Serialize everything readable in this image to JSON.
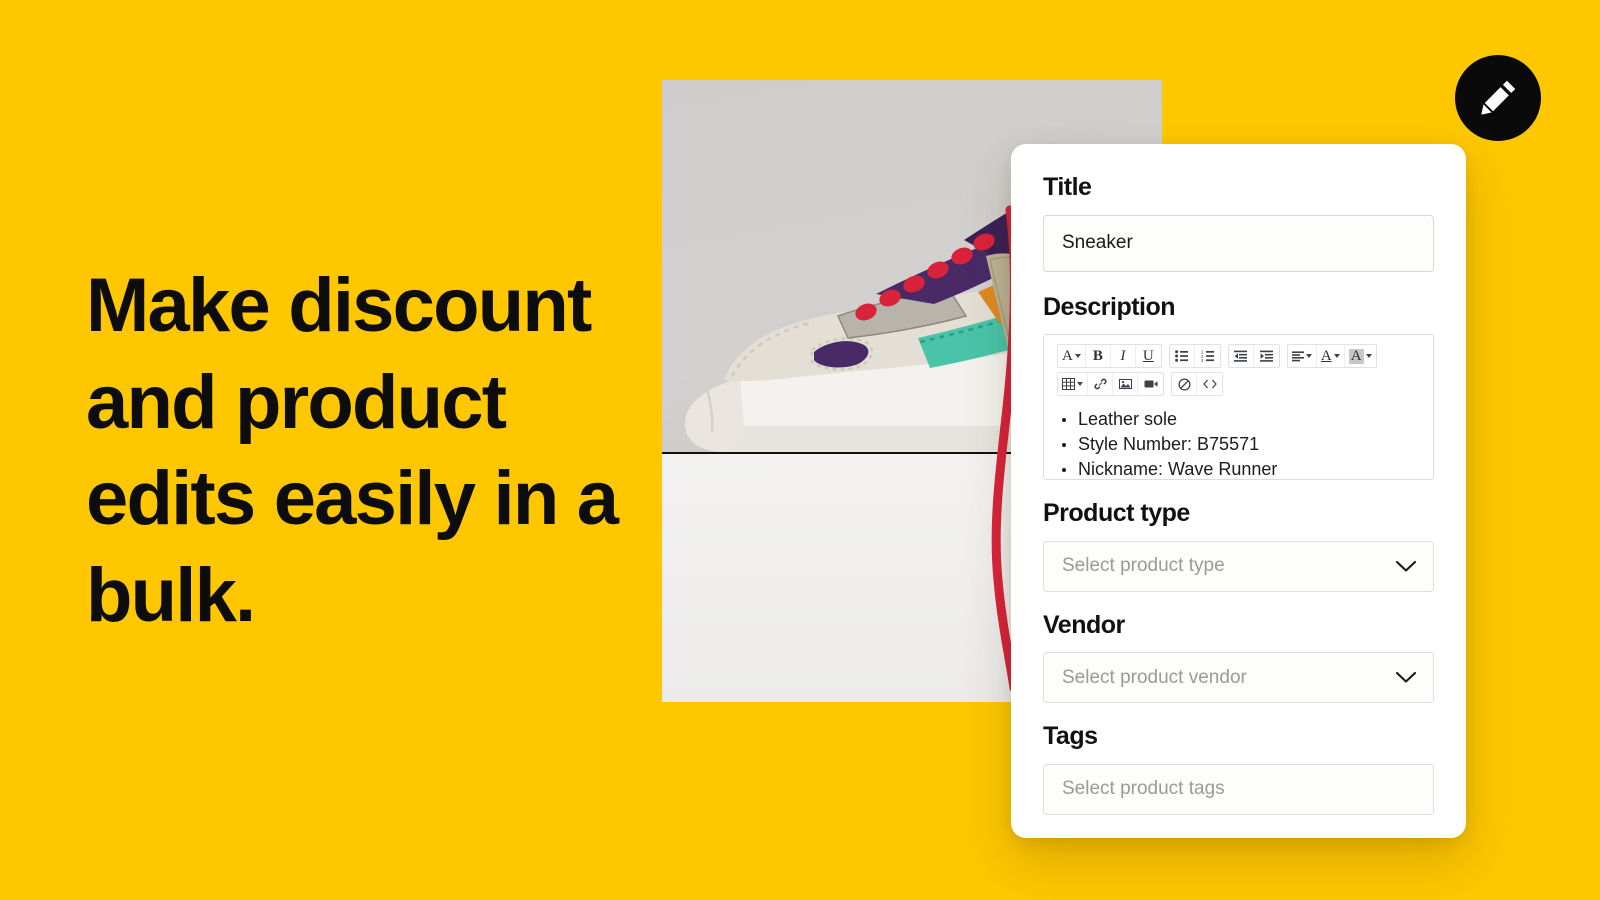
{
  "theme": {
    "background_color": "#FFC700",
    "card_color": "#FFFFFF",
    "badge_color": "#0A0A0A",
    "text_color": "#0D0D0D",
    "placeholder_color": "#9A9A9A"
  },
  "hero": {
    "headline": "Make discount and product edits easily in a bulk."
  },
  "badge": {
    "icon": "pencil-icon"
  },
  "photo": {
    "alt": "multicolour sneaker product photo"
  },
  "form": {
    "title": {
      "label": "Title",
      "value": "Sneaker"
    },
    "description": {
      "label": "Description",
      "toolbar": {
        "row1": [
          {
            "name": "font-family-dropdown",
            "glyph": "A",
            "caret": true
          },
          {
            "name": "bold-button",
            "glyph": "B",
            "caret": false
          },
          {
            "name": "italic-button",
            "glyph": "I",
            "caret": false
          },
          {
            "name": "underline-button",
            "glyph": "U",
            "caret": false
          },
          {
            "name": "bulleted-list-button",
            "glyph": "list-bullet-icon",
            "caret": false
          },
          {
            "name": "numbered-list-button",
            "glyph": "list-numbered-icon",
            "caret": false
          },
          {
            "name": "decrease-indent-button",
            "glyph": "outdent-icon",
            "caret": false
          },
          {
            "name": "increase-indent-button",
            "glyph": "indent-icon",
            "caret": false
          },
          {
            "name": "align-dropdown",
            "glyph": "align-left-icon",
            "caret": true
          },
          {
            "name": "text-color-dropdown",
            "glyph": "A",
            "caret": true
          },
          {
            "name": "highlight-color-dropdown",
            "glyph": "A",
            "caret": true
          }
        ],
        "row2": [
          {
            "name": "table-dropdown",
            "glyph": "table-icon",
            "caret": true
          },
          {
            "name": "insert-link-button",
            "glyph": "link-icon",
            "caret": false
          },
          {
            "name": "insert-image-button",
            "glyph": "image-icon",
            "caret": false
          },
          {
            "name": "insert-video-button",
            "glyph": "video-icon",
            "caret": false
          },
          {
            "name": "clear-formatting-button",
            "glyph": "no-entry-icon",
            "caret": false
          },
          {
            "name": "source-code-button",
            "glyph": "code-icon",
            "caret": false
          }
        ]
      },
      "bullets": [
        "Leather sole",
        "Style Number: B75571",
        "Nickname: Wave Runner"
      ]
    },
    "product_type": {
      "label": "Product type",
      "placeholder": "Select product type",
      "value": ""
    },
    "vendor": {
      "label": "Vendor",
      "placeholder": "Select product vendor",
      "value": ""
    },
    "tags": {
      "label": "Tags",
      "placeholder": "Select product tags",
      "value": ""
    }
  }
}
